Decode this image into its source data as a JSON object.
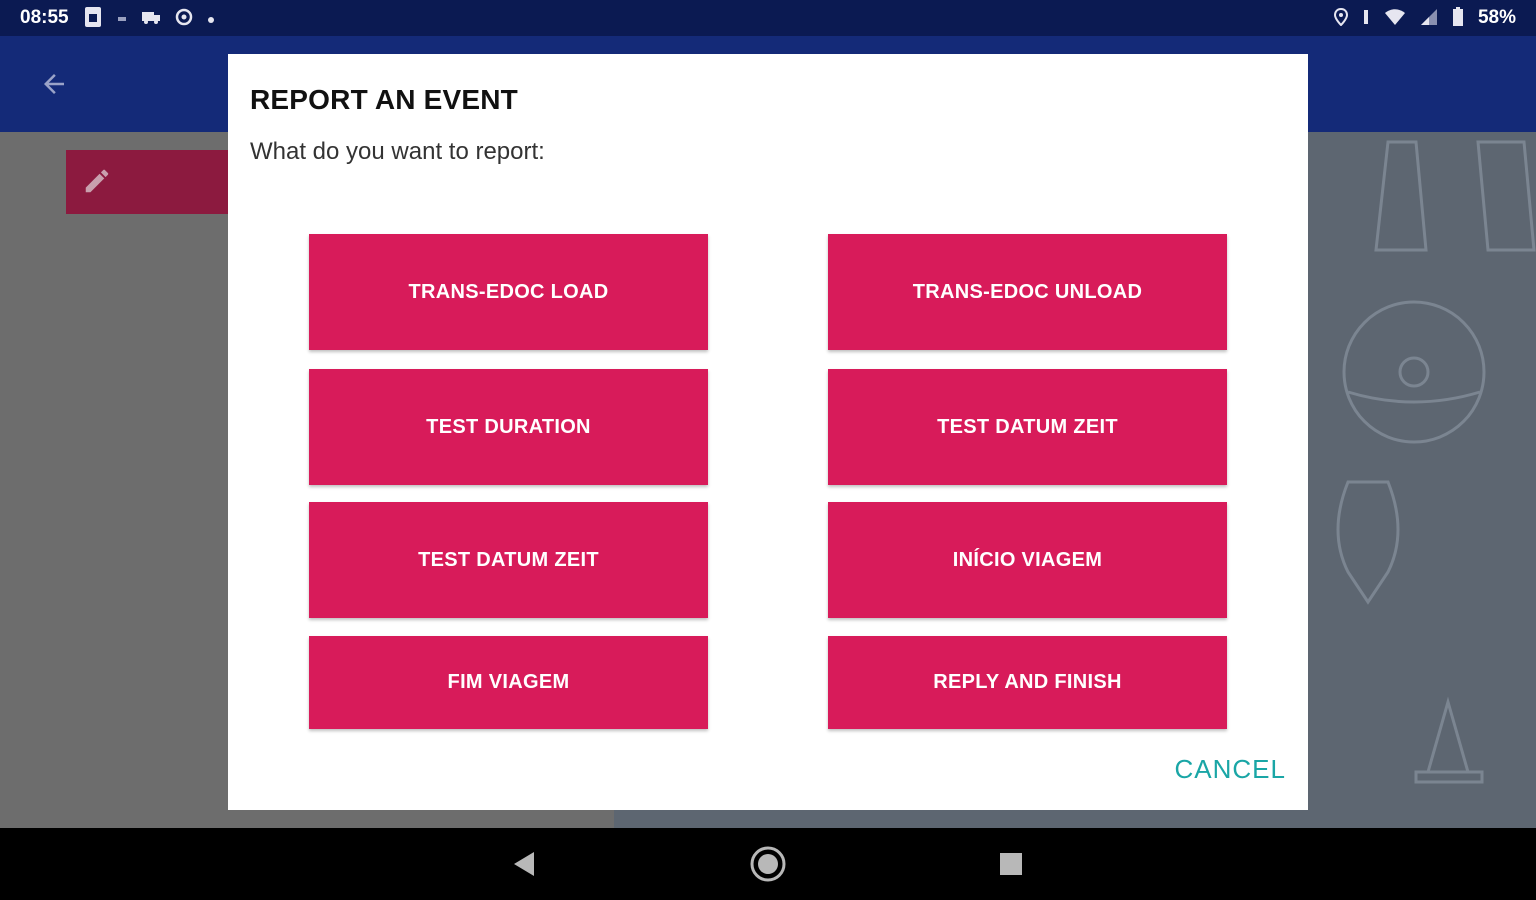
{
  "status_bar": {
    "time": "08:55",
    "battery": "58%",
    "left_icons": [
      "sim-card-icon",
      "notification-dot-icon",
      "truck-icon",
      "sync-icon",
      "more-dot-icon"
    ],
    "right_icons": [
      "location-icon",
      "vibrate-icon",
      "wifi-icon",
      "signal-icon",
      "battery-icon"
    ]
  },
  "colors": {
    "status_bar": "#0b1a52",
    "app_bar": "#142a78",
    "button": "#d81b5a",
    "cancel": "#1aa6a6"
  },
  "dialog": {
    "title": "REPORT AN EVENT",
    "subtitle": "What do you want to report:",
    "buttons": [
      "TRANS-EDOC LOAD",
      "TRANS-EDOC UNLOAD",
      "TEST DURATION",
      "TEST DATUM ZEIT",
      "TEST DATUM ZEIT",
      "INÍCIO VIAGEM",
      "FIM VIAGEM",
      "REPLY AND FINISH"
    ],
    "cancel_label": "CANCEL"
  }
}
